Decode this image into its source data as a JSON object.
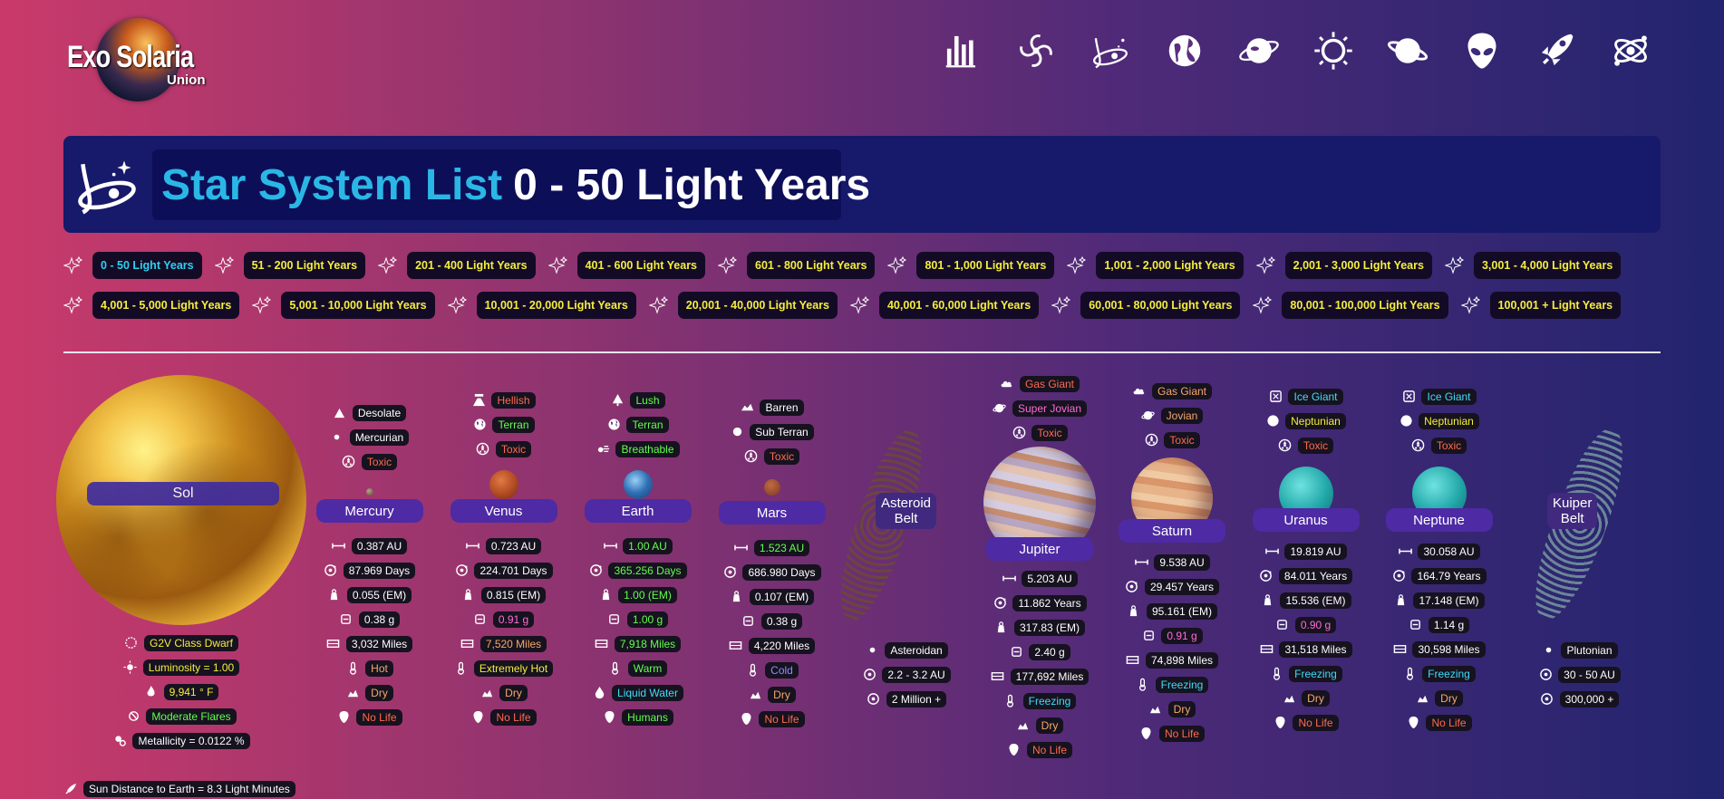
{
  "logo": {
    "main": "Exo Solaria",
    "sub": "Union"
  },
  "nav": [
    "stats-icon",
    "galaxy-icon",
    "star-system-icon",
    "globe-icon",
    "planet-ring-icon",
    "star-icon",
    "saturn-icon",
    "alien-icon",
    "rocket-icon",
    "atom-icon"
  ],
  "title": {
    "part1": "Star System List",
    "part2": "0 - 50 Light Years"
  },
  "ranges": {
    "row1": [
      "0 - 50 Light Years",
      "51 - 200 Light Years",
      "201 - 400 Light Years",
      "401 - 600 Light Years",
      "601 - 800 Light Years",
      "801 - 1,000 Light Years",
      "1,001 - 2,000 Light Years",
      "2,001 - 3,000 Light Years",
      "3,001 - 4,000 Light Years"
    ],
    "row2": [
      "4,001 - 5,000 Light Years",
      "5,001 - 10,000 Light Years",
      "10,001 - 20,000 Light Years",
      "20,001 - 40,000 Light Years",
      "40,001 - 60,000 Light Years",
      "60,001 - 80,000 Light Years",
      "80,001 - 100,000 Light Years",
      "100,001 + Light Years"
    ]
  },
  "sol": {
    "name": "Sol",
    "class": "G2V Class Dwarf",
    "luminosity": "Luminosity = 1.00",
    "temp": "9,941 ° F",
    "flares": "Moderate Flares",
    "metallicity": "Metallicity = 0.0122 %"
  },
  "footer": "Sun Distance to Earth = 8.3 Light Minutes",
  "mercury": {
    "name": "Mercury",
    "t1": "Desolate",
    "t2": "Mercurian",
    "t3": "Toxic",
    "au": "0.387 AU",
    "days": "87.969 Days",
    "em": "0.055 (EM)",
    "g": "0.38 g",
    "miles": "3,032 Miles",
    "temp": "Hot",
    "water": "Dry",
    "life": "No Life"
  },
  "venus": {
    "name": "Venus",
    "t1": "Hellish",
    "t2": "Terran",
    "t3": "Toxic",
    "au": "0.723 AU",
    "days": "224.701 Days",
    "em": "0.815 (EM)",
    "g": "0.91 g",
    "miles": "7,520 Miles",
    "temp": "Extremely Hot",
    "water": "Dry",
    "life": "No Life"
  },
  "earth": {
    "name": "Earth",
    "t1": "Lush",
    "t2": "Terran",
    "t3": "Breathable",
    "au": "1.00 AU",
    "days": "365.256 Days",
    "em": "1.00 (EM)",
    "g": "1.00 g",
    "miles": "7,918 Miles",
    "temp": "Warm",
    "water": "Liquid Water",
    "life": "Humans"
  },
  "mars": {
    "name": "Mars",
    "t1": "Barren",
    "t2": "Sub Terran",
    "t3": "Toxic",
    "au": "1.523 AU",
    "days": "686.980 Days",
    "em": "0.107 (EM)",
    "g": "0.38 g",
    "miles": "4,220 Miles",
    "temp": "Cold",
    "water": "Dry",
    "life": "No Life"
  },
  "asteroid": {
    "name1": "Asteroid",
    "name2": "Belt",
    "type": "Asteroidan",
    "au": "2.2 - 3.2 AU",
    "count": "2 Million +"
  },
  "jupiter": {
    "name": "Jupiter",
    "t1": "Gas Giant",
    "t2": "Super Jovian",
    "t3": "Toxic",
    "au": "5.203 AU",
    "years": "11.862 Years",
    "em": "317.83 (EM)",
    "g": "2.40 g",
    "miles": "177,692 Miles",
    "temp": "Freezing",
    "water": "Dry",
    "life": "No Life"
  },
  "saturn": {
    "name": "Saturn",
    "t1": "Gas Giant",
    "t2": "Jovian",
    "t3": "Toxic",
    "au": "9.538 AU",
    "years": "29.457 Years",
    "em": "95.161 (EM)",
    "g": "0.91 g",
    "miles": "74,898 Miles",
    "temp": "Freezing",
    "water": "Dry",
    "life": "No Life"
  },
  "uranus": {
    "name": "Uranus",
    "t1": "Ice Giant",
    "t2": "Neptunian",
    "t3": "Toxic",
    "au": "19.819 AU",
    "years": "84.011 Years",
    "em": "15.536 (EM)",
    "g": "0.90 g",
    "miles": "31,518 Miles",
    "temp": "Freezing",
    "water": "Dry",
    "life": "No Life"
  },
  "neptune": {
    "name": "Neptune",
    "t1": "Ice Giant",
    "t2": "Neptunian",
    "t3": "Toxic",
    "au": "30.058 AU",
    "years": "164.79 Years",
    "em": "17.148 (EM)",
    "g": "1.14 g",
    "miles": "30,598 Miles",
    "temp": "Freezing",
    "water": "Dry",
    "life": "No Life"
  },
  "kuiper": {
    "name1": "Kuiper",
    "name2": "Belt",
    "type": "Plutonian",
    "au": "30 - 50 AU",
    "count": "300,000 +"
  }
}
